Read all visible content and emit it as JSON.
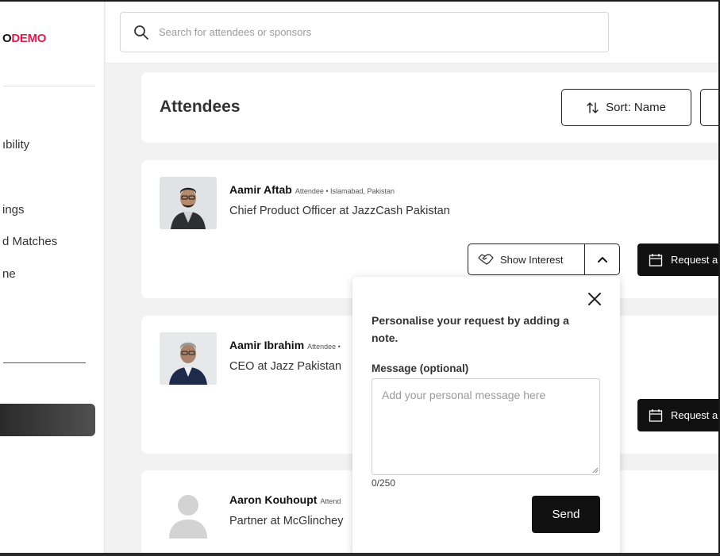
{
  "brand": {
    "prefix": "O",
    "suffix": "DEMO"
  },
  "sidebar": {
    "items": [
      {
        "label": "ıbility"
      },
      {
        "label": "ings"
      },
      {
        "label": "d Matches"
      },
      {
        "label": "ne"
      }
    ]
  },
  "search": {
    "placeholder": "Search for attendees or sponsors",
    "icon": "search-icon"
  },
  "header": {
    "title": "Attendees",
    "sort_label": "Sort: Name"
  },
  "attendees": [
    {
      "name": "Aamir Aftab",
      "meta": "Attendee • Islamabad, Pakistan",
      "title": "Chief Product Officer at JazzCash Pakistan",
      "interest_label": "Show Interest",
      "request_label": "Request a"
    },
    {
      "name": "Aamir Ibrahim",
      "meta": "Attendee •",
      "title": "CEO at Jazz Pakistan",
      "request_label": "Request a"
    },
    {
      "name": "Aaron Kouhoupt",
      "meta": "Attend",
      "title": "Partner at McGlinchey"
    }
  ],
  "popover": {
    "heading": "Personalise your request by adding a note.",
    "message_label": "Message (optional)",
    "message_placeholder": "Add your personal message here",
    "counter": "0/250",
    "send_label": "Send"
  },
  "colors": {
    "brand_accent": "#e6194b",
    "primary_button": "#111111"
  }
}
